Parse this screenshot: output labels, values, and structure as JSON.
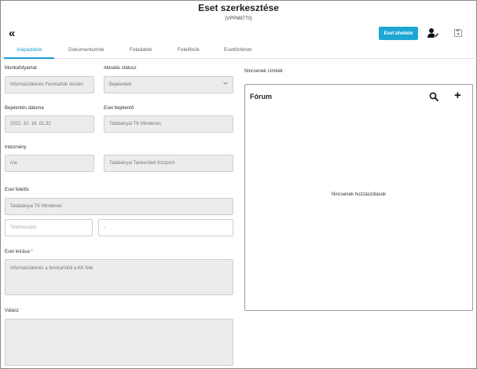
{
  "header": {
    "title": "Eset szerkesztése",
    "case_code": "(VPPM8770)",
    "takeover_label": "Eset átvétele"
  },
  "tabs": [
    {
      "label": "Alapadatok",
      "active": true
    },
    {
      "label": "Dokumentumok",
      "active": false
    },
    {
      "label": "Feladatok",
      "active": false
    },
    {
      "label": "Felelősök",
      "active": false
    },
    {
      "label": "Esettörténet",
      "active": false
    }
  ],
  "form": {
    "workflow": {
      "label": "Munkafolyamat",
      "value": "Információkérés Fenntartók részén"
    },
    "status": {
      "label": "Aktuális státusz",
      "value": "Bejelentett"
    },
    "report_date": {
      "label": "Bejelentés dátuma",
      "value": "2022. 10. 18. 01:32"
    },
    "reporter": {
      "label": "Eset bejelentő",
      "value": "Tatabányai TK Mindenes"
    },
    "institution": {
      "label": "Intézmény",
      "code": "n/a",
      "name": "Tatabányai Tankerületi Központ"
    },
    "responsible": {
      "label": "Eset felelős",
      "value": "Tatabányai TK Mindenes",
      "phone_placeholder": "Telefonszám",
      "phone_extra": "-"
    },
    "description": {
      "label": "Eset leírása",
      "required_mark": "*",
      "value": "Információkérés a fenntartótól a KK felé"
    },
    "answer": {
      "label": "Válasz",
      "value": ""
    }
  },
  "tags": {
    "empty_text": "Nincsenek címkék"
  },
  "forum": {
    "title": "Fórum",
    "empty_text": "Nincsenek hozzászólások"
  },
  "colors": {
    "accent": "#1ea7d4",
    "tab_active": "#1a9dd6",
    "field_bg": "#ececec"
  },
  "icons": [
    "back-double-chevron-icon",
    "user-edit-icon",
    "save-icon",
    "search-icon",
    "plus-icon",
    "chevron-down-icon"
  ]
}
